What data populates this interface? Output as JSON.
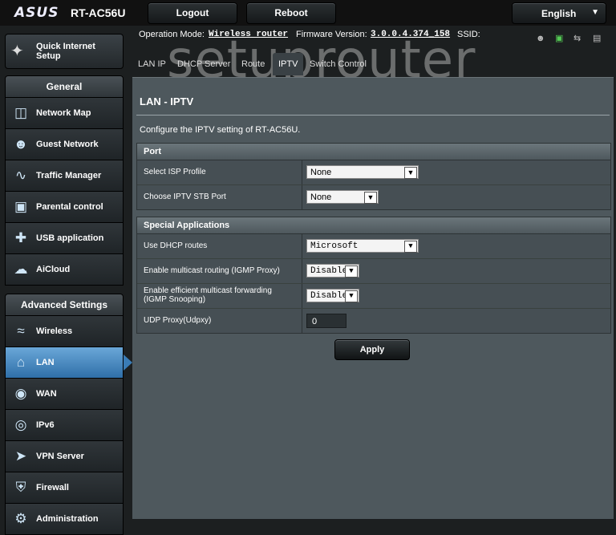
{
  "header": {
    "logo": "ASUS",
    "model": "RT-AC56U",
    "logout_label": "Logout",
    "reboot_label": "Reboot",
    "language": "English"
  },
  "info": {
    "op_mode_label": "Operation Mode:",
    "op_mode_value": "Wireless router",
    "firmware_label": "Firmware Version:",
    "firmware_value": "3.0.0.4.374_158",
    "ssid_label": "SSID:"
  },
  "watermark": "setuprouter",
  "sidebar": {
    "qis_label": "Quick Internet Setup",
    "general_title": "General",
    "general_items": [
      {
        "label": "Network Map",
        "icon": "network-map-icon"
      },
      {
        "label": "Guest Network",
        "icon": "guest-network-icon"
      },
      {
        "label": "Traffic Manager",
        "icon": "traffic-manager-icon"
      },
      {
        "label": "Parental control",
        "icon": "lock-icon"
      },
      {
        "label": "USB application",
        "icon": "puzzle-icon"
      },
      {
        "label": "AiCloud",
        "icon": "cloud-icon"
      }
    ],
    "advanced_title": "Advanced Settings",
    "advanced_items": [
      {
        "label": "Wireless",
        "icon": "wifi-icon"
      },
      {
        "label": "LAN",
        "icon": "home-icon",
        "active": true
      },
      {
        "label": "WAN",
        "icon": "globe-icon"
      },
      {
        "label": "IPv6",
        "icon": "ipv6-icon"
      },
      {
        "label": "VPN Server",
        "icon": "vpn-icon"
      },
      {
        "label": "Firewall",
        "icon": "shield-icon"
      },
      {
        "label": "Administration",
        "icon": "admin-icon"
      }
    ]
  },
  "tabs": [
    {
      "label": "LAN IP"
    },
    {
      "label": "DHCP Server"
    },
    {
      "label": "Route"
    },
    {
      "label": "IPTV",
      "active": true
    },
    {
      "label": "Switch Control"
    }
  ],
  "panel": {
    "title": "LAN - IPTV",
    "description": "Configure the IPTV setting of RT-AC56U.",
    "port": {
      "header": "Port",
      "rows": [
        {
          "label": "Select ISP Profile",
          "value": "None"
        },
        {
          "label": "Choose IPTV STB Port",
          "value": "None"
        }
      ]
    },
    "special": {
      "header": "Special Applications",
      "rows": [
        {
          "label": "Use DHCP routes",
          "value": "Microsoft"
        },
        {
          "label": "Enable multicast routing (IGMP Proxy)",
          "value": "Disable"
        },
        {
          "label": "Enable efficient multicast forwarding (IGMP Snooping)",
          "value": "Disable"
        },
        {
          "label": "UDP Proxy(Udpxy)",
          "value": "0"
        }
      ]
    },
    "apply_label": "Apply"
  }
}
